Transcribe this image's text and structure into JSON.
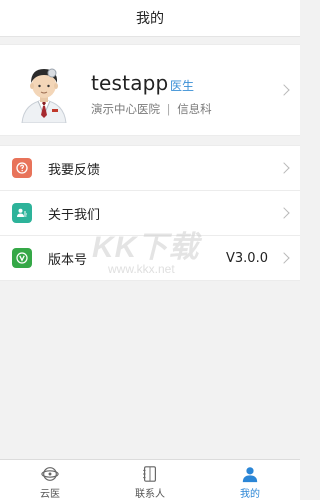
{
  "header": {
    "title": "我的"
  },
  "profile": {
    "name": "testapp",
    "role": "医生",
    "hospital": "演示中心医院",
    "separator": "|",
    "department": "信息科",
    "avatar_icon": "doctor-avatar-icon"
  },
  "menu": {
    "items": [
      {
        "label": "我要反馈",
        "icon": "feedback-icon",
        "icon_color": "#e8735a",
        "value": ""
      },
      {
        "label": "关于我们",
        "icon": "about-us-icon",
        "icon_color": "#2db39a",
        "value": ""
      },
      {
        "label": "版本号",
        "icon": "version-icon",
        "icon_color": "#35a847",
        "value": "V3.0.0"
      }
    ]
  },
  "watermark": {
    "brand": "KK下载",
    "url": "www.kkx.net"
  },
  "tabbar": {
    "tabs": [
      {
        "label": "云医",
        "icon": "cloud-doctor-icon",
        "active": false
      },
      {
        "label": "联系人",
        "icon": "contacts-icon",
        "active": false
      },
      {
        "label": "我的",
        "icon": "profile-icon",
        "active": true
      }
    ]
  },
  "colors": {
    "accent": "#2b86d6",
    "role_badge": "#3a8fd6",
    "background": "#f2f2f2"
  }
}
